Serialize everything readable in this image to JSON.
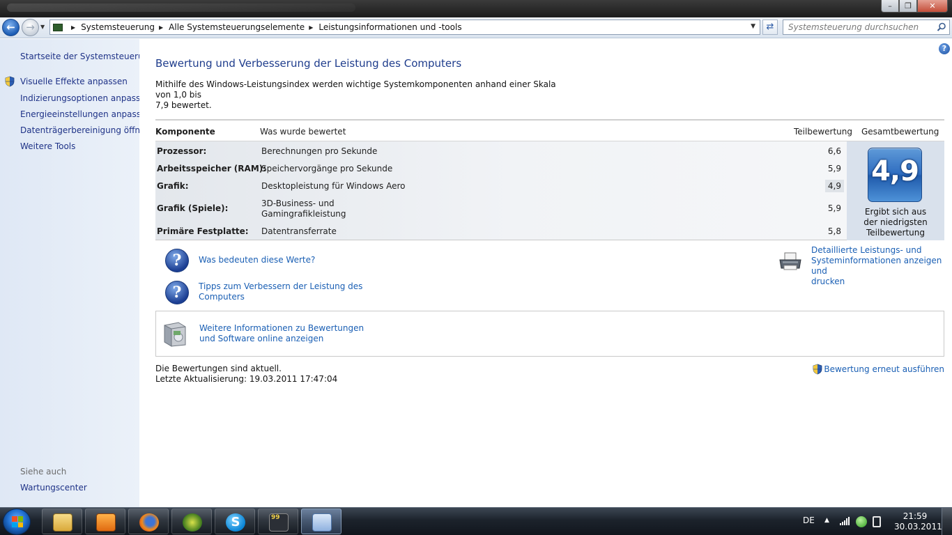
{
  "window": {
    "controls": {
      "minimize": "–",
      "maximize": "❐",
      "close": "✕"
    }
  },
  "addressbar": {
    "crumbs": [
      "Systemsteuerung",
      "Alle Systemsteuerungselemente",
      "Leistungsinformationen und -tools"
    ],
    "search_placeholder": "Systemsteuerung durchsuchen"
  },
  "sidebar": {
    "home_link": "Startseite der Systemsteuerung",
    "tasks": [
      {
        "label": "Visuelle Effekte anpassen",
        "icon": "uac-shield-icon"
      },
      {
        "label": "Indizierungsoptionen anpassen"
      },
      {
        "label": "Energieeinstellungen anpassen"
      },
      {
        "label": "Datenträgerbereinigung öffnen"
      },
      {
        "label": "Weitere Tools"
      }
    ],
    "see_also_heading": "Siehe auch",
    "see_also": [
      {
        "label": "Wartungscenter"
      }
    ]
  },
  "main": {
    "title": "Bewertung und Verbesserung der Leistung des Computers",
    "intro_line1": "Mithilfe des Windows-Leistungsindex werden wichtige Systemkomponenten anhand einer Skala von 1,0 bis",
    "intro_line2": "7,9 bewertet.",
    "table": {
      "headers": {
        "component": "Komponente",
        "assessed": "Was wurde bewertet",
        "subscore": "Teilbewertung",
        "total": "Gesamtbewertung"
      },
      "rows": [
        {
          "component": "Prozessor:",
          "assessed": "Berechnungen pro Sekunde",
          "subscore": "6,6"
        },
        {
          "component": "Arbeitsspeicher (RAM):",
          "assessed": "Speichervorgänge pro Sekunde",
          "subscore": "5,9"
        },
        {
          "component": "Grafik:",
          "assessed": "Desktopleistung für Windows Aero",
          "subscore": "4,9",
          "lowest": true
        },
        {
          "component": "Grafik (Spiele):",
          "assessed_line1": "3D-Business- und",
          "assessed_line2": "Gamingrafikleistung",
          "subscore": "5,9"
        },
        {
          "component": "Primäre Festplatte:",
          "assessed": "Datentransferrate",
          "subscore": "5,8"
        }
      ],
      "total_score": "4,9",
      "total_caption_line1": "Ergibt sich aus",
      "total_caption_line2": "der niedrigsten",
      "total_caption_line3": "Teilbewertung"
    },
    "links": {
      "what_mean": "Was bedeuten diese Werte?",
      "tips_line1": "Tipps zum Verbessern der Leistung des",
      "tips_line2": "Computers",
      "details_line1": "Detaillierte Leistungs- und",
      "details_line2": "Systeminformationen anzeigen und",
      "details_line3": "drucken",
      "online_line1": "Weitere Informationen zu Bewertungen",
      "online_line2": "und Software online anzeigen"
    },
    "status_line1": "Die Bewertungen sind aktuell.",
    "status_line2": "Letzte Aktualisierung: 19.03.2011 17:47:04",
    "rerun": "Bewertung erneut ausführen"
  },
  "taskbar": {
    "apps": [
      {
        "name": "explorer",
        "icon": "folder-icon"
      },
      {
        "name": "media-player",
        "icon": "media-player-icon"
      },
      {
        "name": "firefox",
        "icon": "firefox-icon"
      },
      {
        "name": "app-x",
        "icon": "x-app-icon"
      },
      {
        "name": "skype",
        "icon": "skype-icon"
      },
      {
        "name": "app-99",
        "icon": "app-99-icon"
      },
      {
        "name": "control-panel",
        "icon": "control-panel-icon",
        "active": true
      }
    ],
    "lang": "DE",
    "time": "21:59",
    "date": "30.03.2011"
  }
}
